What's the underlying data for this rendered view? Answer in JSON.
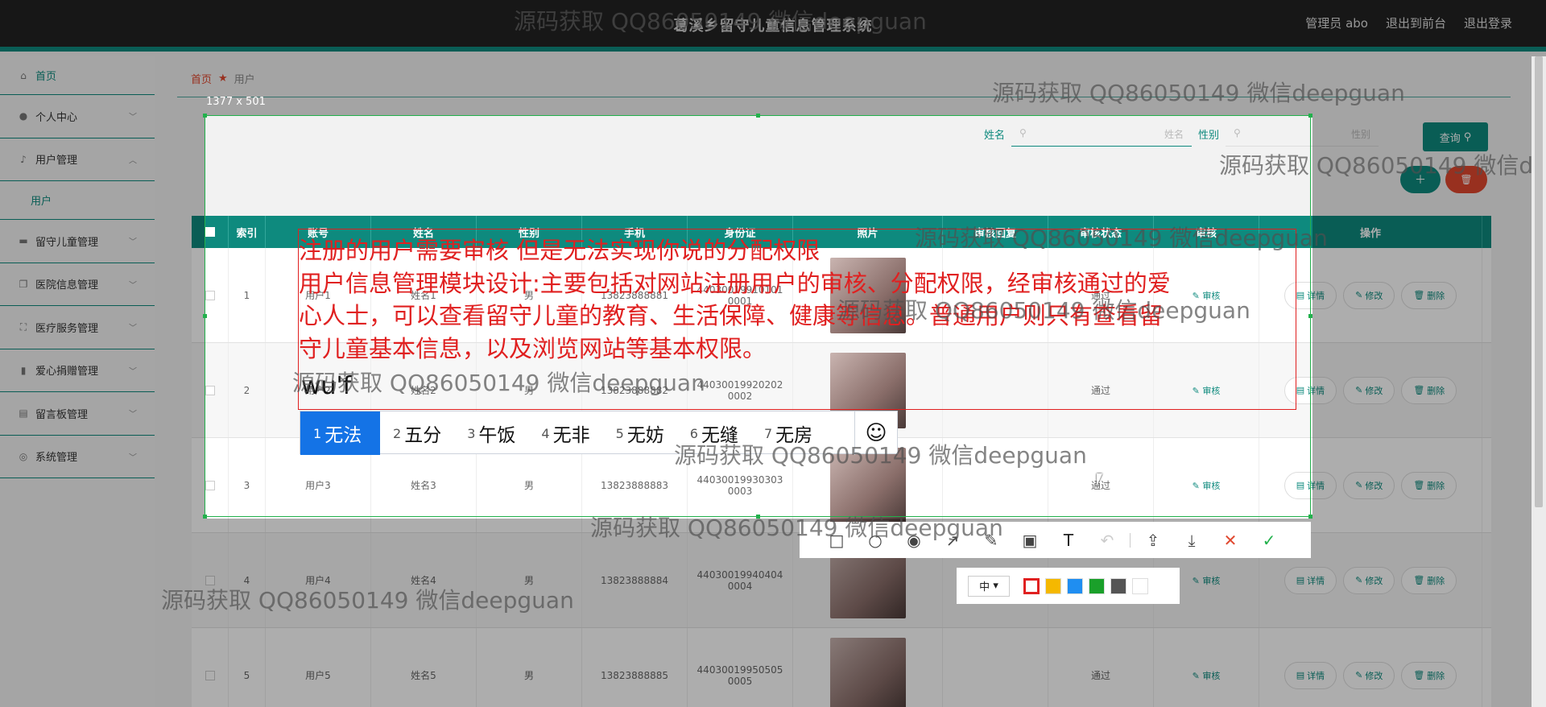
{
  "header": {
    "title": "葛溪乡留守儿童信息管理系统",
    "nav": [
      "管理员 abo",
      "退出到前台",
      "退出登录"
    ]
  },
  "sidebar": {
    "items": [
      {
        "label": "首页",
        "icon": "home-icon"
      },
      {
        "label": "个人中心",
        "icon": "user-icon"
      },
      {
        "label": "用户管理",
        "icon": "mic-icon"
      },
      {
        "label": "用户",
        "icon": ""
      },
      {
        "label": "留守儿童管理",
        "icon": "monitor-icon"
      },
      {
        "label": "医院信息管理",
        "icon": "copy-icon"
      },
      {
        "label": "医疗服务管理",
        "icon": "frame-icon"
      },
      {
        "label": "爱心捐赠管理",
        "icon": "bar-chart-icon"
      },
      {
        "label": "留言板管理",
        "icon": "clipboard-icon"
      },
      {
        "label": "系统管理",
        "icon": "compass-icon"
      }
    ]
  },
  "breadcrumb": {
    "home": "首页",
    "current": "用户"
  },
  "search": {
    "name_label": "姓名",
    "name_placeholder": "姓名",
    "gender_label": "性别",
    "gender_placeholder": "性别",
    "query_label": "查询"
  },
  "table": {
    "headers": [
      "索引",
      "账号",
      "姓名",
      "性别",
      "手机",
      "身份证",
      "照片",
      "审核回复",
      "审核状态",
      "审核",
      "操作"
    ],
    "rows": [
      {
        "index": "1",
        "account": "用户1",
        "name": "姓名1",
        "gender": "男",
        "phone": "13823888881",
        "id1": "44030019910101",
        "id2": "0001",
        "status": "通过",
        "audit": "审核"
      },
      {
        "index": "2",
        "account": "用户2",
        "name": "姓名2",
        "gender": "男",
        "phone": "13823888882",
        "id1": "44030019920202",
        "id2": "0002",
        "status": "通过",
        "audit": "审核"
      },
      {
        "index": "3",
        "account": "用户3",
        "name": "姓名3",
        "gender": "男",
        "phone": "13823888883",
        "id1": "44030019930303",
        "id2": "0003",
        "status": "通过",
        "audit": "审核"
      },
      {
        "index": "4",
        "account": "用户4",
        "name": "姓名4",
        "gender": "男",
        "phone": "13823888884",
        "id1": "44030019940404",
        "id2": "0004",
        "status": "通过",
        "audit": "审核"
      },
      {
        "index": "5",
        "account": "用户5",
        "name": "姓名5",
        "gender": "男",
        "phone": "13823888885",
        "id1": "44030019950505",
        "id2": "0005",
        "status": "通过",
        "audit": "审核"
      }
    ],
    "ops": {
      "detail": "详情",
      "edit": "修改",
      "delete": "删除"
    }
  },
  "capture": {
    "size_label": "1377 x 501",
    "size_select": "中",
    "colors": [
      "#e02020",
      "#f5b800",
      "#1f8ef1",
      "#1aa02a",
      "#555555",
      "#ffffff"
    ]
  },
  "annotation": {
    "lines": [
      "注册的用户需要审核 但是无法实现你说的分配权限",
      "用户信息管理模块设计:主要包括对网站注册用户的审核、分配权限，经审核通过的爱",
      "心人士，可以查看留守儿童的教育、生活保障、健康等信息。普通用户则只有查看留",
      "守儿童基本信息，以及浏览网站等基本权限。"
    ]
  },
  "ime": {
    "input": "wu'f",
    "candidates": [
      {
        "n": "1",
        "w": "无法"
      },
      {
        "n": "2",
        "w": "五分"
      },
      {
        "n": "3",
        "w": "午饭"
      },
      {
        "n": "4",
        "w": "无非"
      },
      {
        "n": "5",
        "w": "无妨"
      },
      {
        "n": "6",
        "w": "无缝"
      },
      {
        "n": "7",
        "w": "无房"
      }
    ]
  },
  "watermark": "源码获取 QQ86050149 微信deepguan"
}
